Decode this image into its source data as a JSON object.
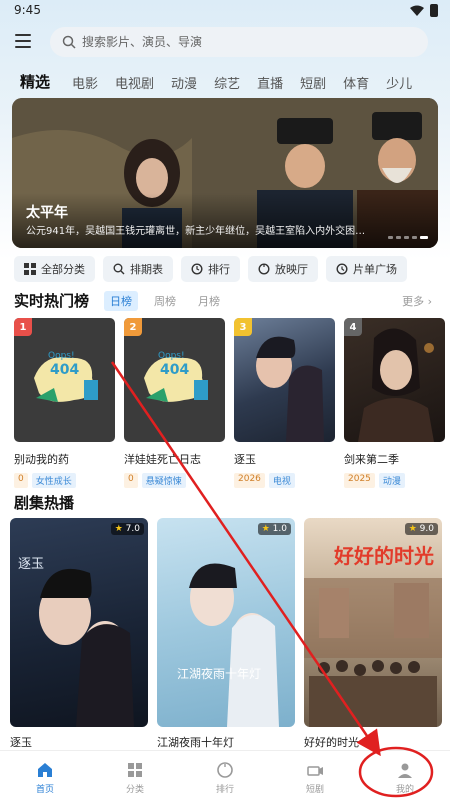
{
  "status": {
    "time": "9:45"
  },
  "search": {
    "placeholder": "搜索影片、演员、导演"
  },
  "tabs": [
    "精选",
    "电影",
    "电视剧",
    "动漫",
    "综艺",
    "直播",
    "短剧",
    "体育",
    "少儿"
  ],
  "banner": {
    "title": "太平年",
    "description": "公元941年，吴越国王钱元瓘离世，新主少年继位，吴越王室陷入内外交困…"
  },
  "quick_buttons": [
    {
      "label": "全部分类",
      "icon": "grid-icon"
    },
    {
      "label": "排期表",
      "icon": "search-icon"
    },
    {
      "label": "排行",
      "icon": "trophy-icon"
    },
    {
      "label": "放映厅",
      "icon": "circle-icon"
    },
    {
      "label": "片单广场",
      "icon": "history-icon"
    }
  ],
  "hot": {
    "title": "实时热门榜",
    "rank_tabs": [
      "日榜",
      "周榜",
      "月榜"
    ],
    "more": "更多 ›",
    "items": [
      {
        "rank": "1",
        "name": "别动我的药",
        "year": "0",
        "genre": "女性成长",
        "badge_color": "#e8504a"
      },
      {
        "rank": "2",
        "name": "洋娃娃死亡日志",
        "year": "0",
        "genre": "悬疑惊悚",
        "badge_color": "#f09a3a"
      },
      {
        "rank": "3",
        "name": "逐玉",
        "year": "2026",
        "genre": "电视",
        "badge_color": "#f2c230"
      },
      {
        "rank": "4",
        "name": "剑来第二季",
        "year": "2025",
        "genre": "动漫",
        "badge_color": "#666666"
      }
    ],
    "placeholder_text": {
      "oops": "Oops!",
      "code": "404"
    }
  },
  "drama": {
    "title": "剧集热播",
    "items": [
      {
        "name": "逐玉",
        "score": "7.0",
        "poster_text": "逐玉"
      },
      {
        "name": "江湖夜雨十年灯",
        "score": "1.0",
        "poster_text": "江湖夜雨十年灯"
      },
      {
        "name": "好好的时光",
        "score": "9.0",
        "poster_text": "好好的时光"
      }
    ]
  },
  "nav": [
    {
      "label": "首页",
      "icon": "home-icon",
      "active": true
    },
    {
      "label": "分类",
      "icon": "category-icon",
      "active": false
    },
    {
      "label": "排行",
      "icon": "rank-icon",
      "active": false
    },
    {
      "label": "短剧",
      "icon": "short-drama-icon",
      "active": false
    },
    {
      "label": "我的",
      "icon": "profile-icon",
      "active": false
    }
  ],
  "colors": {
    "accent": "#2a7fd4",
    "annotation": "#e02020"
  }
}
